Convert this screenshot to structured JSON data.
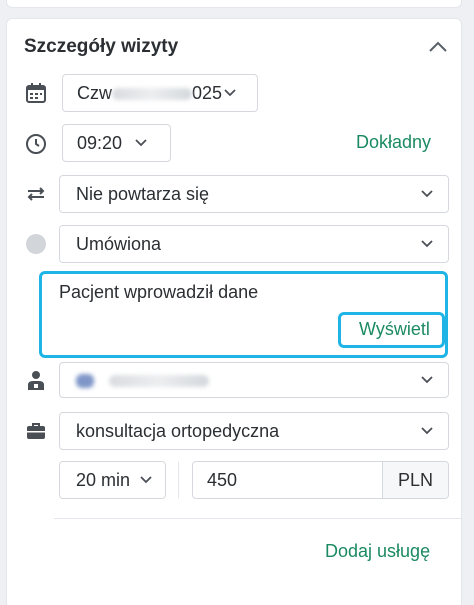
{
  "panel": {
    "title": "Szczegóły wizyty",
    "date_prefix": "Czw",
    "date_suffix": "025",
    "time": "09:20",
    "precise_link": "Dokładny",
    "repeat": "Nie powtarza się",
    "status": "Umówiona",
    "patient_message": "Pacjent wprowadził dane",
    "show_button": "Wyświetl",
    "service": "konsultacja ortopedyczna",
    "duration": "20 min",
    "price": "450",
    "currency": "PLN",
    "add_service": "Dodaj usługę"
  },
  "colors": {
    "accent": "#1b8a62",
    "highlight": "#1fb4e6"
  },
  "icons": [
    "calendar-icon",
    "clock-icon",
    "repeat-icon",
    "status-dot-icon",
    "doctor-icon",
    "briefcase-icon",
    "chevron-down-icon",
    "chevron-up-icon"
  ]
}
